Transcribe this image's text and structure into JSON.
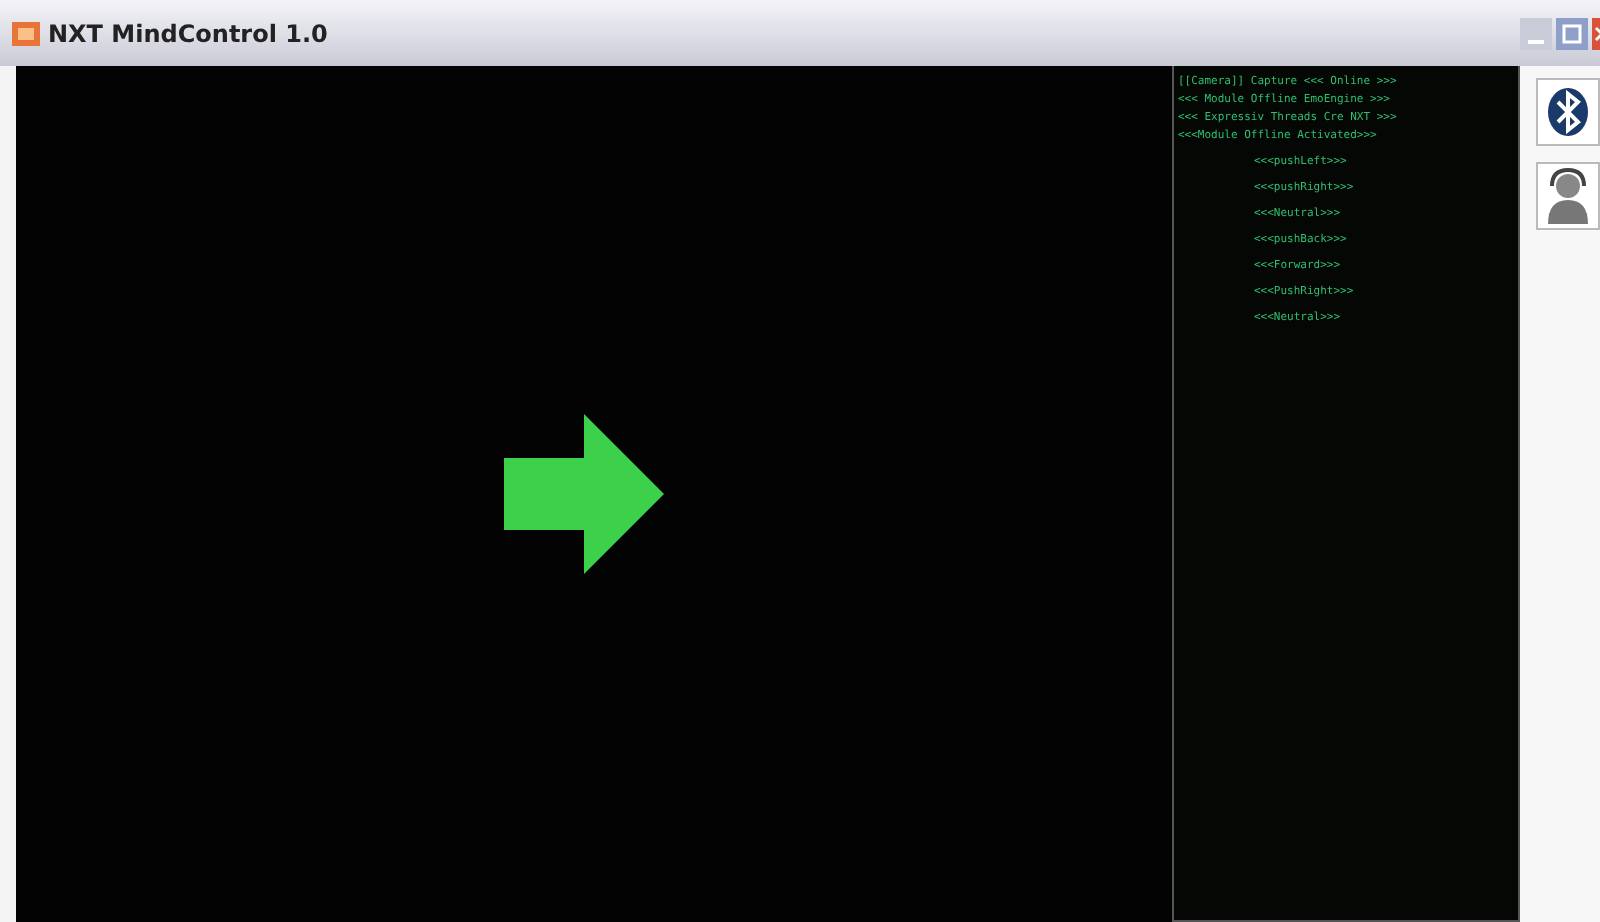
{
  "window": {
    "title": "NXT MindControl 1.0"
  },
  "log": {
    "status_lines": [
      "[[Camera]] Capture <<< Online >>>",
      "<<< Module Offline EmoEngine >>>",
      "<<< Expressiv Threads Cre NXT >>>",
      "<<<Module Offline Activated>>>"
    ],
    "command_lines": [
      "<<<pushLeft>>>",
      "<<<pushRight>>>",
      "<<<Neutral>>>",
      "<<<pushBack>>>",
      "<<<Forward>>>",
      "<<<PushRight>>>",
      "<<<Neutral>>>"
    ]
  }
}
